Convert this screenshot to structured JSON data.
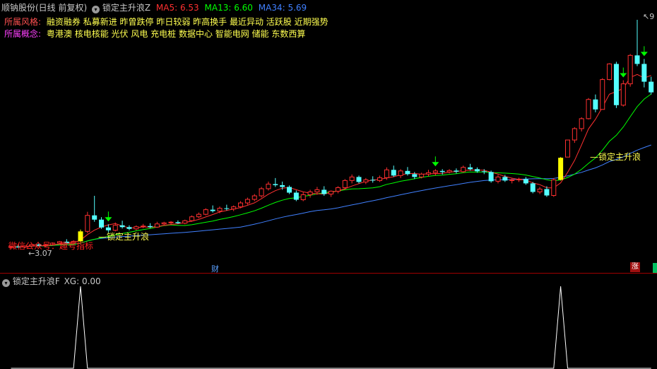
{
  "header": {
    "stock_title": "顺钠股份(日线 前复权)",
    "indicator_name": "锁定主升浪Z",
    "ma5": "MA5: 6.53",
    "ma13": "MA13: 6.60",
    "ma34": "MA34: 5.69"
  },
  "info": {
    "style_label": "所属风格:",
    "style_values": "融资融券 私募新进 昨曾跌停 昨日较弱 昨高换手 最近异动 活跃股 近期强势",
    "concept_label": "所属概念:",
    "concept_values": "粤港澳 核电核能 光伏 风电 充电桩 数据中心 智能电网 储能 东数西算"
  },
  "annotations": {
    "signal_label_1": "锁定主升浪",
    "signal_label_2": "锁定主升浪",
    "watermark": "微信公众号：趣号指标",
    "low_price": "3.07",
    "high_price_partial": "9",
    "finance_marker": "财",
    "limit_up_marker": "涨"
  },
  "sub": {
    "indicator_name": "锁定主升浪F",
    "xg_value": "XG: 0.00"
  },
  "colors": {
    "ma5": "#ff3030",
    "ma13": "#00ff00",
    "ma34": "#4080ff",
    "up": "#ff3030",
    "down": "#54ffff",
    "signal": "#ffff00",
    "label_red": "#ff5050",
    "label_magenta": "#ff40ff",
    "info_text": "#ffff50",
    "divider": "#a00000"
  },
  "chart_data": {
    "type": "candlestick",
    "ohlc": [
      [
        3.1,
        3.14,
        3.07,
        3.12
      ],
      [
        3.12,
        3.16,
        3.09,
        3.11
      ],
      [
        3.11,
        3.15,
        3.08,
        3.14
      ],
      [
        3.14,
        3.2,
        3.12,
        3.18
      ],
      [
        3.18,
        3.22,
        3.13,
        3.15
      ],
      [
        3.15,
        3.19,
        3.12,
        3.17
      ],
      [
        3.17,
        3.24,
        3.15,
        3.22
      ],
      [
        3.22,
        3.28,
        3.19,
        3.26
      ],
      [
        3.26,
        3.33,
        3.2,
        3.22
      ],
      [
        3.22,
        3.3,
        3.2,
        3.27
      ],
      [
        3.27,
        3.6,
        3.25,
        3.55
      ],
      [
        3.55,
        4.1,
        3.5,
        4.0
      ],
      [
        4.0,
        4.55,
        3.82,
        3.88
      ],
      [
        3.88,
        3.95,
        3.62,
        3.66
      ],
      [
        3.66,
        3.75,
        3.52,
        3.58
      ],
      [
        3.58,
        3.8,
        3.55,
        3.72
      ],
      [
        3.72,
        3.85,
        3.63,
        3.67
      ],
      [
        3.67,
        3.72,
        3.58,
        3.62
      ],
      [
        3.62,
        3.72,
        3.58,
        3.68
      ],
      [
        3.68,
        3.76,
        3.64,
        3.7
      ],
      [
        3.7,
        3.78,
        3.64,
        3.67
      ],
      [
        3.67,
        3.82,
        3.65,
        3.76
      ],
      [
        3.76,
        3.82,
        3.72,
        3.79
      ],
      [
        3.79,
        3.84,
        3.74,
        3.81
      ],
      [
        3.81,
        3.86,
        3.76,
        3.78
      ],
      [
        3.78,
        3.88,
        3.75,
        3.85
      ],
      [
        3.85,
        4.0,
        3.82,
        3.96
      ],
      [
        3.96,
        4.08,
        3.92,
        4.03
      ],
      [
        4.03,
        4.2,
        4.0,
        4.16
      ],
      [
        4.16,
        4.28,
        4.08,
        4.12
      ],
      [
        4.12,
        4.25,
        4.06,
        4.2
      ],
      [
        4.2,
        4.3,
        4.14,
        4.18
      ],
      [
        4.18,
        4.28,
        4.12,
        4.24
      ],
      [
        4.24,
        4.4,
        4.2,
        4.35
      ],
      [
        4.35,
        4.5,
        4.3,
        4.45
      ],
      [
        4.45,
        4.6,
        4.4,
        4.55
      ],
      [
        4.55,
        4.8,
        4.5,
        4.75
      ],
      [
        4.75,
        4.95,
        4.7,
        4.88
      ],
      [
        4.88,
        5.05,
        4.8,
        4.85
      ],
      [
        4.85,
        4.95,
        4.72,
        4.8
      ],
      [
        4.8,
        4.84,
        4.6,
        4.64
      ],
      [
        4.64,
        4.7,
        4.4,
        4.44
      ],
      [
        4.44,
        4.65,
        4.4,
        4.58
      ],
      [
        4.58,
        4.72,
        4.5,
        4.66
      ],
      [
        4.66,
        4.8,
        4.58,
        4.72
      ],
      [
        4.72,
        4.82,
        4.55,
        4.6
      ],
      [
        4.6,
        4.7,
        4.52,
        4.68
      ],
      [
        4.68,
        4.82,
        4.62,
        4.78
      ],
      [
        4.78,
        5.02,
        4.72,
        4.98
      ],
      [
        4.98,
        5.15,
        4.9,
        5.08
      ],
      [
        5.08,
        5.12,
        4.9,
        4.94
      ],
      [
        4.94,
        5.05,
        4.88,
        5.0
      ],
      [
        5.0,
        5.1,
        4.92,
        4.98
      ],
      [
        4.98,
        5.12,
        4.94,
        5.06
      ],
      [
        5.06,
        5.35,
        5.0,
        5.28
      ],
      [
        5.28,
        5.4,
        5.08,
        5.12
      ],
      [
        5.12,
        5.3,
        5.05,
        5.25
      ],
      [
        5.25,
        5.36,
        5.12,
        5.16
      ],
      [
        5.16,
        5.22,
        5.02,
        5.08
      ],
      [
        5.08,
        5.2,
        5.04,
        5.16
      ],
      [
        5.16,
        5.28,
        5.1,
        5.2
      ],
      [
        5.2,
        5.3,
        5.12,
        5.25
      ],
      [
        5.25,
        5.3,
        5.15,
        5.22
      ],
      [
        5.22,
        5.3,
        5.18,
        5.26
      ],
      [
        5.26,
        5.32,
        5.18,
        5.23
      ],
      [
        5.23,
        5.4,
        5.2,
        5.35
      ],
      [
        5.35,
        5.45,
        5.26,
        5.3
      ],
      [
        5.3,
        5.35,
        5.2,
        5.24
      ],
      [
        5.24,
        5.3,
        5.16,
        5.22
      ],
      [
        5.22,
        5.26,
        4.92,
        4.96
      ],
      [
        4.96,
        5.14,
        4.9,
        5.08
      ],
      [
        5.08,
        5.14,
        4.94,
        4.98
      ],
      [
        4.98,
        5.04,
        4.9,
        5.0
      ],
      [
        5.0,
        5.06,
        4.94,
        5.02
      ],
      [
        5.02,
        5.08,
        4.86,
        4.9
      ],
      [
        4.9,
        4.94,
        4.62,
        4.66
      ],
      [
        4.66,
        4.8,
        4.6,
        4.74
      ],
      [
        4.74,
        4.82,
        4.52,
        4.56
      ],
      [
        4.56,
        5.05,
        4.52,
        5.0
      ],
      [
        5.0,
        5.64,
        4.98,
        5.62
      ],
      [
        5.64,
        6.12,
        5.64,
        6.12
      ],
      [
        6.12,
        6.48,
        6.04,
        6.44
      ],
      [
        6.44,
        6.76,
        6.36,
        6.72
      ],
      [
        6.72,
        7.3,
        6.7,
        7.26
      ],
      [
        7.26,
        7.4,
        6.9,
        6.98
      ],
      [
        6.98,
        7.86,
        6.98,
        7.82
      ],
      [
        7.82,
        8.28,
        7.8,
        8.26
      ],
      [
        8.26,
        8.32,
        7.02,
        7.1
      ],
      [
        7.1,
        7.8,
        7.06,
        7.7
      ],
      [
        7.7,
        8.54,
        7.62,
        8.5
      ],
      [
        8.5,
        9.5,
        8.2,
        8.26
      ],
      [
        8.26,
        8.4,
        7.6,
        7.76
      ],
      [
        7.76,
        7.9,
        7.4,
        7.46
      ]
    ],
    "ma_values": {
      "MA5": 6.53,
      "MA13": 6.6,
      "MA34": 5.69
    },
    "series_names": [
      "MA5",
      "MA13",
      "MA34"
    ],
    "xg_signal": [
      0,
      0,
      0,
      0,
      0,
      0,
      0,
      0,
      0,
      0,
      1,
      0,
      0,
      0,
      0,
      0,
      0,
      0,
      0,
      0,
      0,
      0,
      0,
      0,
      0,
      0,
      0,
      0,
      0,
      0,
      0,
      0,
      0,
      0,
      0,
      0,
      0,
      0,
      0,
      0,
      0,
      0,
      0,
      0,
      0,
      0,
      0,
      0,
      0,
      0,
      0,
      0,
      0,
      0,
      0,
      0,
      0,
      0,
      0,
      0,
      0,
      0,
      0,
      0,
      0,
      0,
      0,
      0,
      0,
      0,
      0,
      0,
      0,
      0,
      0,
      0,
      0,
      0,
      0,
      1,
      0,
      0,
      0,
      0,
      0,
      0,
      0,
      0,
      0,
      0,
      0,
      0,
      0
    ],
    "low_label_value": 3.07,
    "y_range": [
      2.9,
      9.7
    ]
  }
}
